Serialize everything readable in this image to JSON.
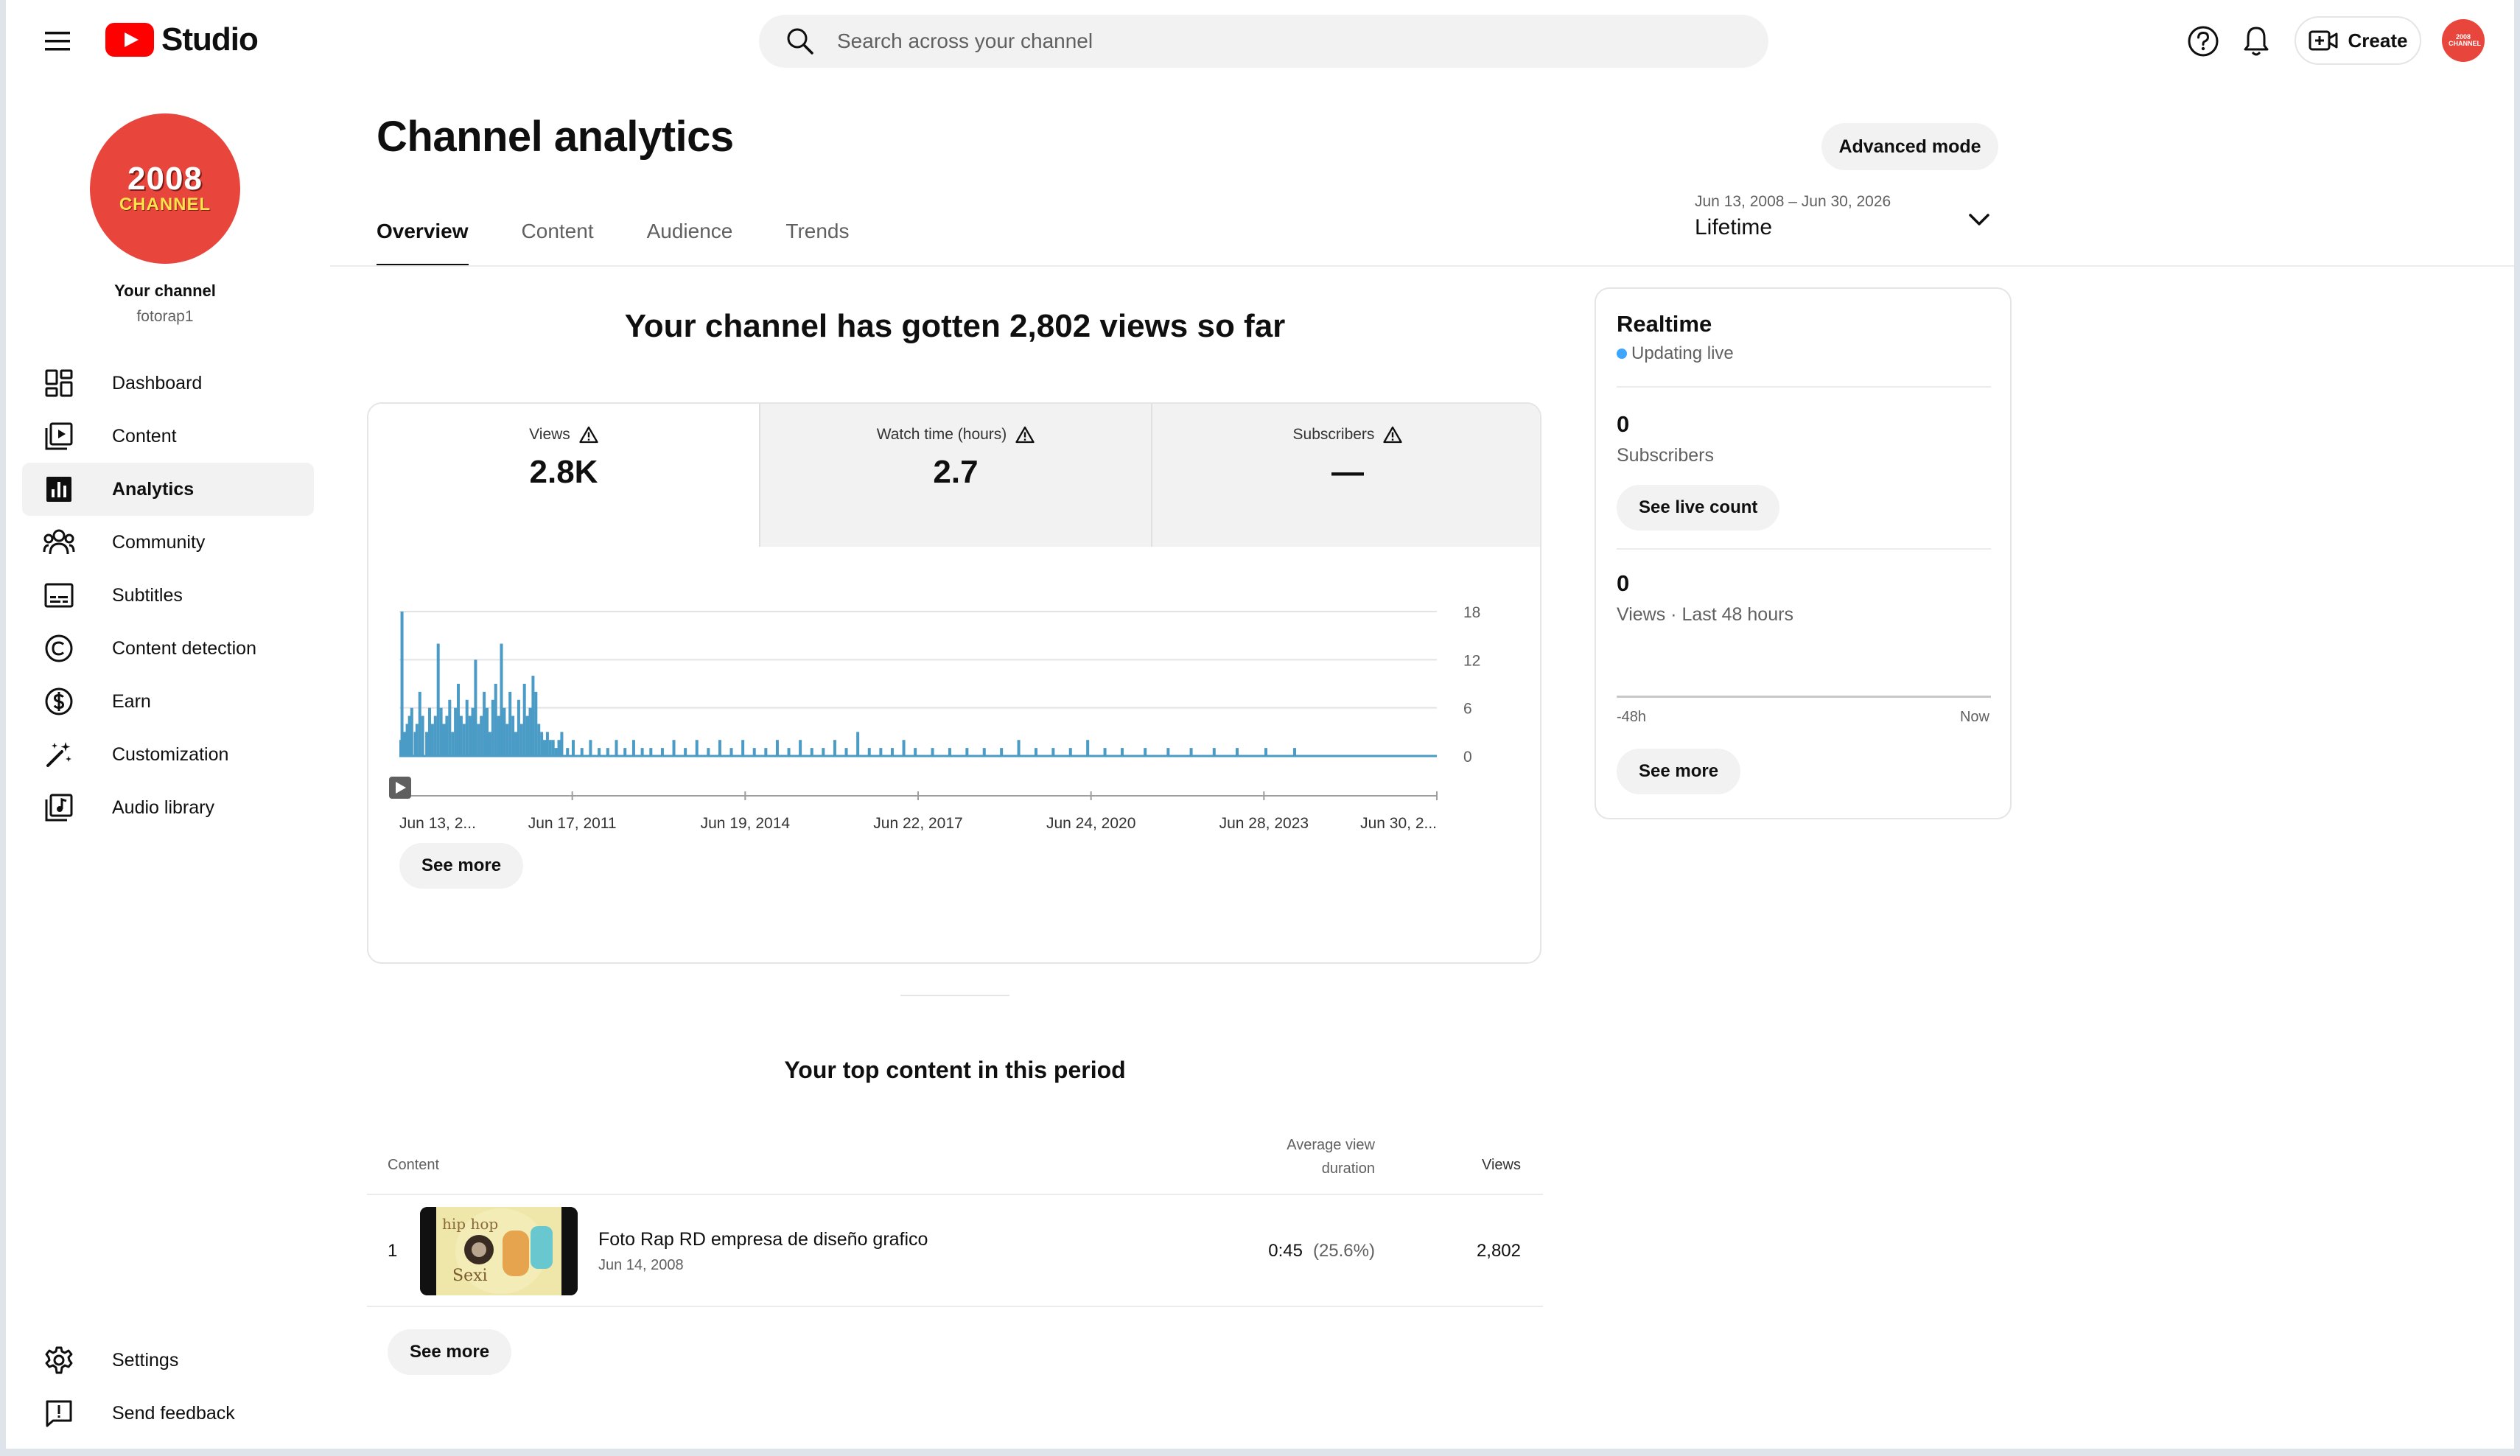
{
  "topbar": {
    "brand": "Studio",
    "search_placeholder": "Search across your channel",
    "create_label": "Create",
    "avatar_text": "2008 CHANNEL"
  },
  "sidebar": {
    "avatar_line1": "2008",
    "avatar_line2": "CHANNEL",
    "your_channel": "Your channel",
    "handle": "fotorap1",
    "items": [
      {
        "label": "Dashboard",
        "icon": "dashboard-icon"
      },
      {
        "label": "Content",
        "icon": "content-icon"
      },
      {
        "label": "Analytics",
        "icon": "analytics-icon",
        "active": true
      },
      {
        "label": "Community",
        "icon": "community-icon"
      },
      {
        "label": "Subtitles",
        "icon": "subtitles-icon"
      },
      {
        "label": "Content detection",
        "icon": "copyright-icon"
      },
      {
        "label": "Earn",
        "icon": "dollar-icon"
      },
      {
        "label": "Customization",
        "icon": "magic-wand-icon"
      },
      {
        "label": "Audio library",
        "icon": "audio-library-icon"
      }
    ],
    "bottom": [
      {
        "label": "Settings",
        "icon": "gear-icon"
      },
      {
        "label": "Send feedback",
        "icon": "feedback-icon"
      }
    ]
  },
  "header": {
    "title": "Channel analytics",
    "advanced_mode": "Advanced mode",
    "tabs": [
      {
        "label": "Overview",
        "active": true
      },
      {
        "label": "Content"
      },
      {
        "label": "Audience"
      },
      {
        "label": "Trends"
      }
    ],
    "date_range": "Jun 13, 2008 – Jun 30, 2026",
    "period": "Lifetime"
  },
  "overview": {
    "headline": "Your channel has gotten 2,802 views so far",
    "metrics": [
      {
        "label": "Views",
        "value": "2.8K",
        "active": true
      },
      {
        "label": "Watch time (hours)",
        "value": "2.7"
      },
      {
        "label": "Subscribers",
        "value": "—"
      }
    ],
    "see_more": "See more"
  },
  "chart_data": {
    "type": "bar",
    "title": "",
    "xlabel": "",
    "ylabel": "",
    "x_tick_labels": [
      "Jun 13, 2...",
      "Jun 17, 2011",
      "Jun 19, 2014",
      "Jun 22, 2017",
      "Jun 24, 2020",
      "Jun 28, 2023",
      "Jun 30, 2..."
    ],
    "y_ticks": [
      0,
      6,
      12,
      18
    ],
    "ylim": [
      0,
      18
    ],
    "x_range": [
      2008.45,
      2026.5
    ],
    "grid": true,
    "y_axis_position": "right",
    "color": "#4a9bc6",
    "series": [
      {
        "x": [
          2008.45,
          2008.47,
          2008.52,
          2008.56,
          2008.6,
          2008.64,
          2008.7,
          2008.73,
          2008.78,
          2008.83,
          2008.9,
          2008.95,
          2009.0,
          2009.05,
          2009.1,
          2009.15,
          2009.2,
          2009.25,
          2009.3,
          2009.35,
          2009.4,
          2009.45,
          2009.5,
          2009.55,
          2009.6,
          2009.65,
          2009.7,
          2009.75,
          2009.8,
          2009.85,
          2009.9,
          2009.95,
          2010.0,
          2010.05,
          2010.1,
          2010.15,
          2010.2,
          2010.25,
          2010.3,
          2010.35,
          2010.4,
          2010.45,
          2010.5,
          2010.55,
          2010.6,
          2010.65,
          2010.7,
          2010.75,
          2010.8,
          2010.85,
          2010.9,
          2010.95,
          2011.0,
          2011.05,
          2011.1,
          2011.15,
          2011.2,
          2011.25,
          2011.35,
          2011.45,
          2011.6,
          2011.75,
          2011.9,
          2012.05,
          2012.2,
          2012.35,
          2012.5,
          2012.65,
          2012.8,
          2013.0,
          2013.2,
          2013.4,
          2013.6,
          2013.8,
          2014.0,
          2014.2,
          2014.4,
          2014.6,
          2014.8,
          2015.0,
          2015.2,
          2015.4,
          2015.6,
          2015.8,
          2016.0,
          2016.2,
          2016.4,
          2016.6,
          2016.8,
          2017.0,
          2017.2,
          2017.4,
          2017.7,
          2018.0,
          2018.3,
          2018.6,
          2018.9,
          2019.2,
          2019.5,
          2019.8,
          2020.1,
          2020.4,
          2020.7,
          2021.0,
          2021.4,
          2021.8,
          2022.2,
          2022.6,
          2023.0,
          2023.5,
          2024.0
        ],
        "values": [
          2,
          18,
          3,
          4,
          5,
          6,
          3,
          4,
          8,
          5,
          3,
          6,
          4,
          5,
          14,
          6,
          4,
          5,
          7,
          3,
          6,
          9,
          5,
          4,
          7,
          5,
          6,
          12,
          4,
          5,
          8,
          6,
          3,
          7,
          9,
          5,
          14,
          6,
          4,
          8,
          5,
          3,
          7,
          4,
          9,
          5,
          6,
          10,
          8,
          4,
          3,
          2,
          3,
          2,
          2,
          1,
          2,
          3,
          1,
          2,
          1,
          2,
          1,
          1,
          2,
          1,
          2,
          1,
          1,
          1,
          2,
          1,
          2,
          1,
          2,
          1,
          2,
          1,
          1,
          2,
          1,
          2,
          1,
          1,
          2,
          1,
          3,
          1,
          1,
          1,
          2,
          1,
          1,
          1,
          1,
          1,
          1,
          2,
          1,
          1,
          1,
          2,
          1,
          1,
          1,
          1,
          1,
          1,
          1,
          1,
          1
        ]
      }
    ]
  },
  "top_content": {
    "title": "Your top content in this period",
    "col_content": "Content",
    "col_avd": "Average view duration",
    "col_views": "Views",
    "rows": [
      {
        "rank": "1",
        "title": "Foto Rap RD empresa de diseño grafico",
        "date": "Jun 14, 2008",
        "avd": "0:45",
        "avd_pct": "(25.6%)",
        "views": "2,802",
        "thumb_text": "hip hop Sexi"
      }
    ],
    "see_more": "See more"
  },
  "realtime": {
    "title": "Realtime",
    "status": "Updating live",
    "subscribers_value": "0",
    "subscribers_label": "Subscribers",
    "see_live_count": "See live count",
    "views_value": "0",
    "views_label": "Views · Last 48 hours",
    "tick_start": "-48h",
    "tick_end": "Now",
    "see_more": "See more"
  }
}
